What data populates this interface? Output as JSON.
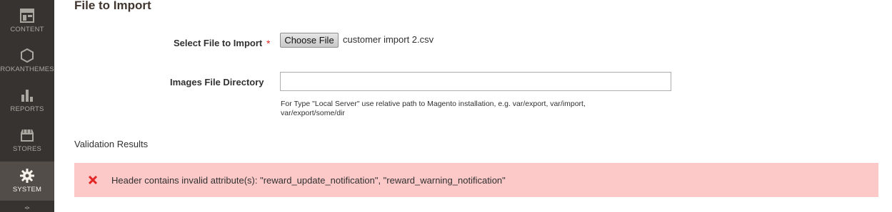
{
  "sidebar": {
    "items": [
      {
        "label": "CONTENT",
        "icon": "content-icon"
      },
      {
        "label": "ROKANTHEMES",
        "icon": "hexagon-icon"
      },
      {
        "label": "REPORTS",
        "icon": "bar-chart-icon"
      },
      {
        "label": "STORES",
        "icon": "store-icon"
      },
      {
        "label": "SYSTEM",
        "icon": "gear-icon",
        "active": true
      },
      {
        "label": "",
        "icon": "cube-icon"
      }
    ]
  },
  "main": {
    "section_title": "File to Import",
    "select_file": {
      "label": "Select File to Import",
      "required_marker": "*",
      "button_label": "Choose File",
      "file_name": "customer import 2.csv"
    },
    "images_dir": {
      "label": "Images File Directory",
      "value": "",
      "note": "For Type \"Local Server\" use relative path to Magento installation, e.g. var/export, var/import, var/export/some/dir"
    },
    "validation": {
      "heading": "Validation Results",
      "error_message": "Header contains invalid attribute(s): \"reward_update_notification\", \"reward_warning_notification\"",
      "error_color": "#e22626",
      "background_color": "#fdc9c8"
    }
  }
}
